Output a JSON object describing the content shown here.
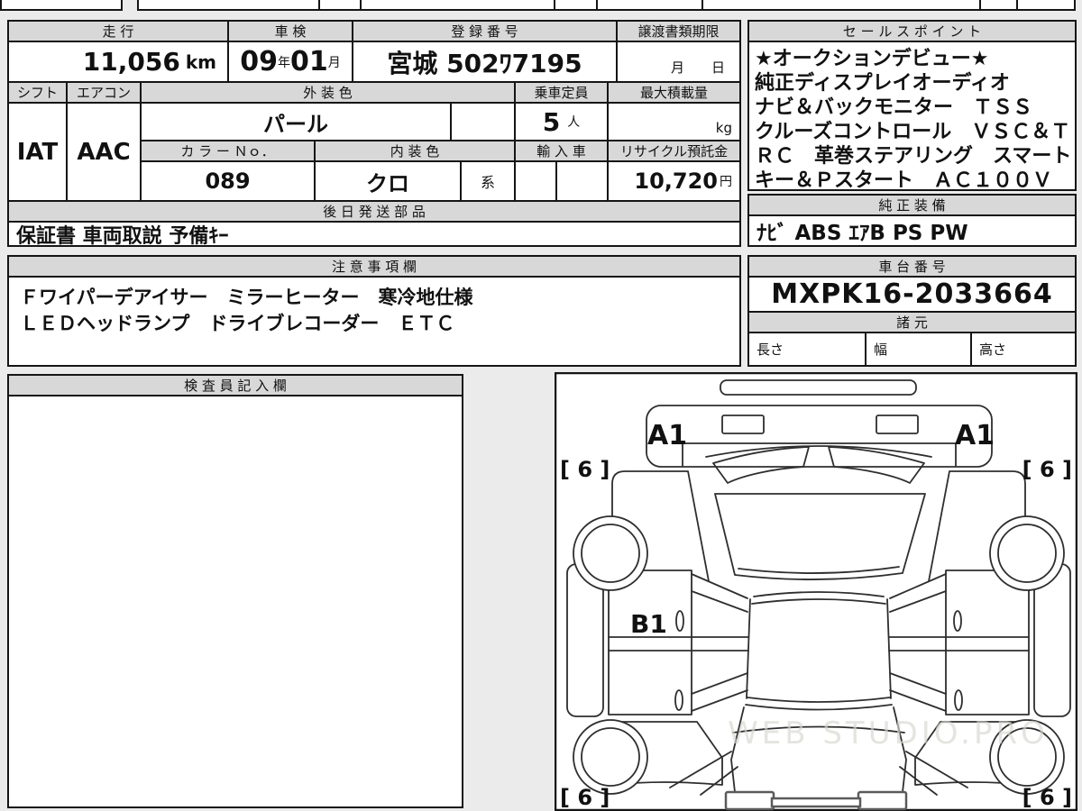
{
  "colors": {
    "page_bg": "#ebebeb",
    "header_bg": "#d8d8d8",
    "cell_bg": "#ffffff",
    "border": "#151515",
    "watermark": "#d6d6d0"
  },
  "spec_table": {
    "row1": {
      "h_mileage": "走 行",
      "h_shaken": "車 検",
      "h_registration": "登 録 番 号",
      "h_deadline": "譲渡書類期限"
    },
    "row2": {
      "mileage": "11,056",
      "mileage_unit": "km",
      "shaken_year": "09",
      "shaken_year_unit": "年",
      "shaken_month": "01",
      "shaken_month_unit": "月",
      "registration": "宮城 502ﾜ7195",
      "deadline_blank": "月　　日"
    },
    "row3": {
      "h_shift": "シフト",
      "h_aircon": "エアコン",
      "h_ext_color": "外 装 色",
      "h_capacity": "乗車定員",
      "h_max_load": "最大積載量"
    },
    "row4": {
      "shift": "IAT",
      "aircon": "AAC",
      "ext_color": "パール",
      "capacity": "5",
      "capacity_unit": "人",
      "max_load_unit": "kg"
    },
    "row5": {
      "h_color_no": "カ ラ ー Ｎｏ．",
      "h_int_color": "内 装 色",
      "h_import": "輸 入 車",
      "h_recycle": "リサイクル預託金"
    },
    "row6": {
      "color_no": "089",
      "int_color": "クロ",
      "int_color_suffix": "系",
      "recycle": "10,720",
      "recycle_unit": "円"
    },
    "row7": {
      "h_later_parts": "後 日 発 送 部 品"
    },
    "row8": {
      "later_parts": "保証書 車両取説 予備ｷｰ"
    }
  },
  "sales_box": {
    "header": "セ ー ル ス ポ イ ン ト",
    "lines": [
      "★オークションデビュー★",
      "純正ディスプレイオーディオ",
      "ナビ＆バックモニター　ＴＳＳ",
      "クルーズコントロール　ＶＳＣ＆Ｔ",
      "ＲＣ　革巻ステアリング　スマート",
      "キー＆Ｐスタート　ＡＣ１００Ｖ"
    ]
  },
  "equipment_box": {
    "header": "純 正 装 備",
    "value": "ﾅﾋﾞ  ABS  ｴｱB  PS  PW"
  },
  "notes_box": {
    "header": "注 意 事 項 欄",
    "lines": [
      "Ｆワイパーデアイサー　ミラーヒーター　寒冷地仕様",
      "ＬＥＤヘッドランプ　ドライブレコーダー　ＥＴＣ"
    ]
  },
  "chassis_box": {
    "header": "車 台 番 号",
    "value": "MXPK16-2033664",
    "specs_header": "諸 元",
    "spec_length": "長さ",
    "spec_width": "幅",
    "spec_height": "高さ"
  },
  "inspector_box": {
    "header": "検 査 員 記 入 欄"
  },
  "diagram": {
    "label_a1_left": "A1",
    "label_a1_right": "A1",
    "label_b1": "B1",
    "corner_top_left": "[ 6 ]",
    "corner_top_right": "[ 6 ]",
    "corner_bottom_left": "[ 6 ]",
    "corner_bottom_right": "[ 6 ]",
    "watermark": "WEB STUDIO.PRO"
  }
}
